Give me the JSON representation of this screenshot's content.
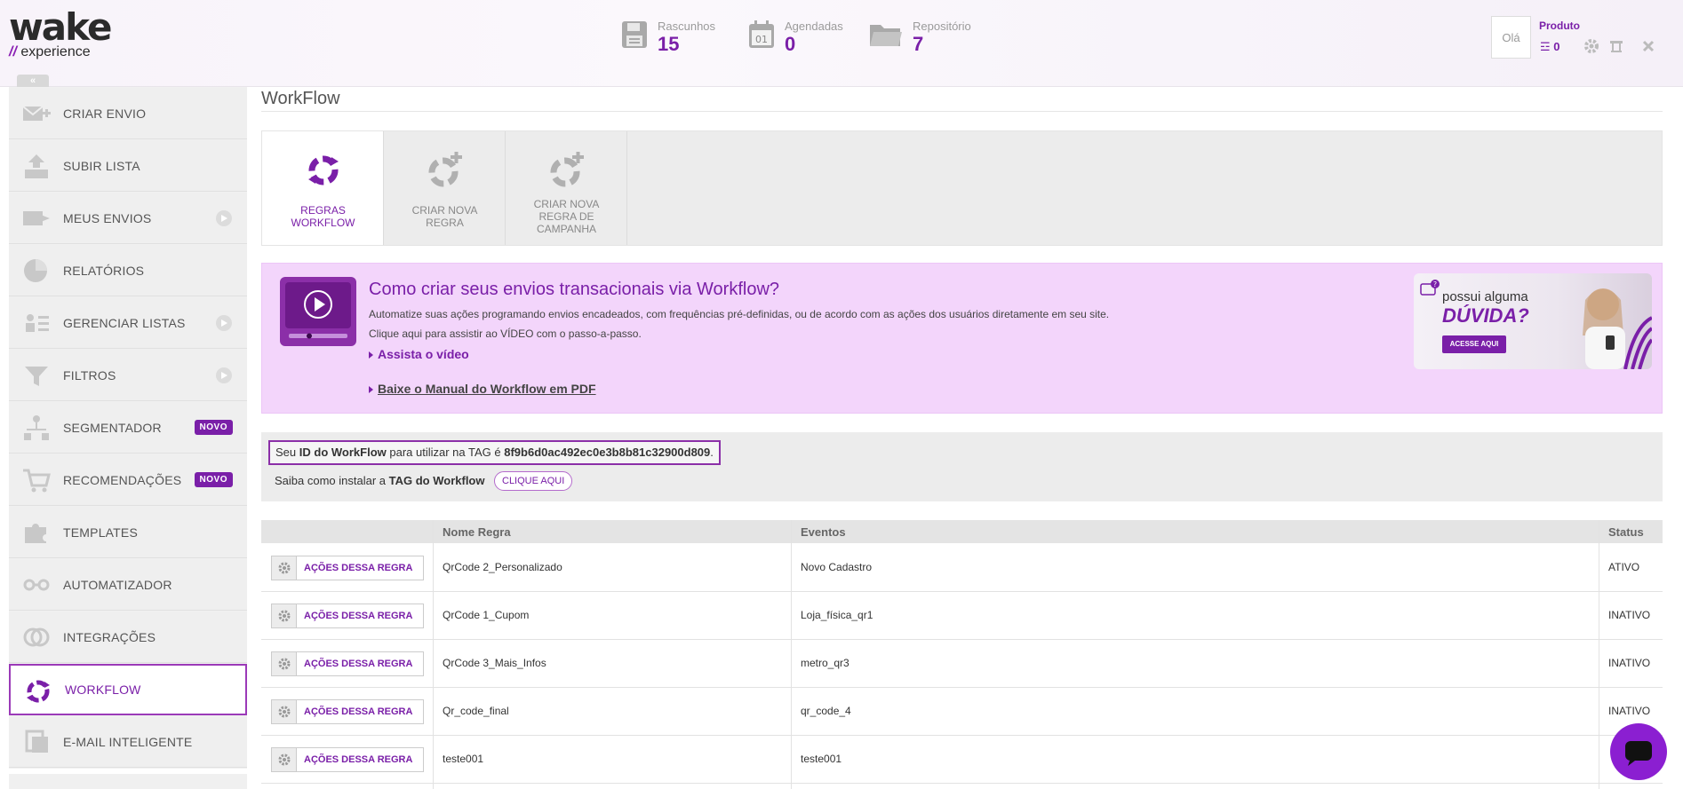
{
  "header": {
    "logo_main": "wake",
    "logo_prefix": "//",
    "logo_sub": "experience",
    "stats": [
      {
        "label": "Rascunhos",
        "value": "15",
        "icon": "floppy-icon"
      },
      {
        "label": "Agendadas",
        "value": "0",
        "icon": "calendar-icon"
      },
      {
        "label": "Repositório",
        "value": "7",
        "icon": "folder-icon"
      }
    ],
    "user_label": "Olá",
    "product_label": "Produto",
    "rss_count": "0"
  },
  "sidebar": {
    "collapse_label": "«",
    "items": [
      {
        "label": "CRIAR ENVIO",
        "icon": "envelope-plus-icon"
      },
      {
        "label": "SUBIR LISTA",
        "icon": "upload-list-icon"
      },
      {
        "label": "MEUS ENVIOS",
        "icon": "envelope-arrow-icon"
      },
      {
        "label": "RELATÓRIOS",
        "icon": "pie-chart-icon"
      },
      {
        "label": "GERENCIAR LISTAS",
        "icon": "users-list-icon"
      },
      {
        "label": "FILTROS",
        "icon": "filter-icon"
      },
      {
        "label": "SEGMENTADOR",
        "icon": "hierarchy-icon",
        "badge": "NOVO"
      },
      {
        "label": "RECOMENDAÇÕES",
        "icon": "cart-icon",
        "badge": "NOVO"
      },
      {
        "label": "TEMPLATES",
        "icon": "puzzle-icon"
      },
      {
        "label": "AUTOMATIZADOR",
        "icon": "automation-icon"
      },
      {
        "label": "INTEGRAÇÕES",
        "icon": "rings-icon"
      },
      {
        "label": "WORKFLOW",
        "icon": "workflow-icon"
      },
      {
        "label": "E-MAIL INTELIGENTE",
        "icon": "smart-email-icon"
      }
    ]
  },
  "main": {
    "title": "WorkFlow",
    "tabs": [
      {
        "line1": "REGRAS",
        "line2": "WORKFLOW",
        "line3": "",
        "line4": ""
      },
      {
        "line1": "CRIAR NOVA",
        "line2": "REGRA",
        "line3": "",
        "line4": ""
      },
      {
        "line1": "CRIAR NOVA",
        "line2": "REGRA DE",
        "line3": "CAMPANHA",
        "line4": ""
      }
    ],
    "promo": {
      "title": "Como criar seus envios transacionais via Workflow?",
      "text1": "Automatize suas ações programando envios encadeados, com frequências pré-definidas, ou de acordo com as ações dos usuários diretamente em seu site.",
      "text2": "Clique aqui para assistir ao VÍDEO com o passo-a-passo.",
      "link_video": "Assista o vídeo",
      "link_pdf": "Baixe o Manual do Workflow em PDF",
      "ad_line1": "possui alguma",
      "ad_line2": "DÚVIDA?",
      "ad_button": "ACESSE AQUI"
    },
    "id_box": {
      "prefix": "Seu",
      "bold1": "ID do WorkFlow",
      "middle": "para utilizar na TAG é",
      "id_value": "8f9b6d0ac492ec0e3b8b81c32900d809",
      "suffix": ".",
      "tag_prefix": "Saiba como instalar a",
      "tag_bold": "TAG do Workflow",
      "clique": "CLIQUE AQUI"
    },
    "table": {
      "headers": {
        "name": "Nome Regra",
        "events": "Eventos",
        "status": "Status"
      },
      "action_label": "AÇÕES DESSA REGRA",
      "rows": [
        {
          "name": "QrCode 2_Personalizado",
          "events": "Novo Cadastro",
          "status": "ATIVO"
        },
        {
          "name": "QrCode 1_Cupom",
          "events": "Loja_física_qr1",
          "status": "INATIVO"
        },
        {
          "name": "QrCode 3_Mais_Infos",
          "events": "metro_qr3",
          "status": "INATIVO"
        },
        {
          "name": "Qr_code_final",
          "events": "qr_code_4",
          "status": "INATIVO"
        },
        {
          "name": "teste001",
          "events": "teste001",
          "status": ""
        }
      ]
    }
  },
  "colors": {
    "accent": "#7a1fa8",
    "promo_bg": "#f3d5fb",
    "chat": "#8b1fd1"
  }
}
